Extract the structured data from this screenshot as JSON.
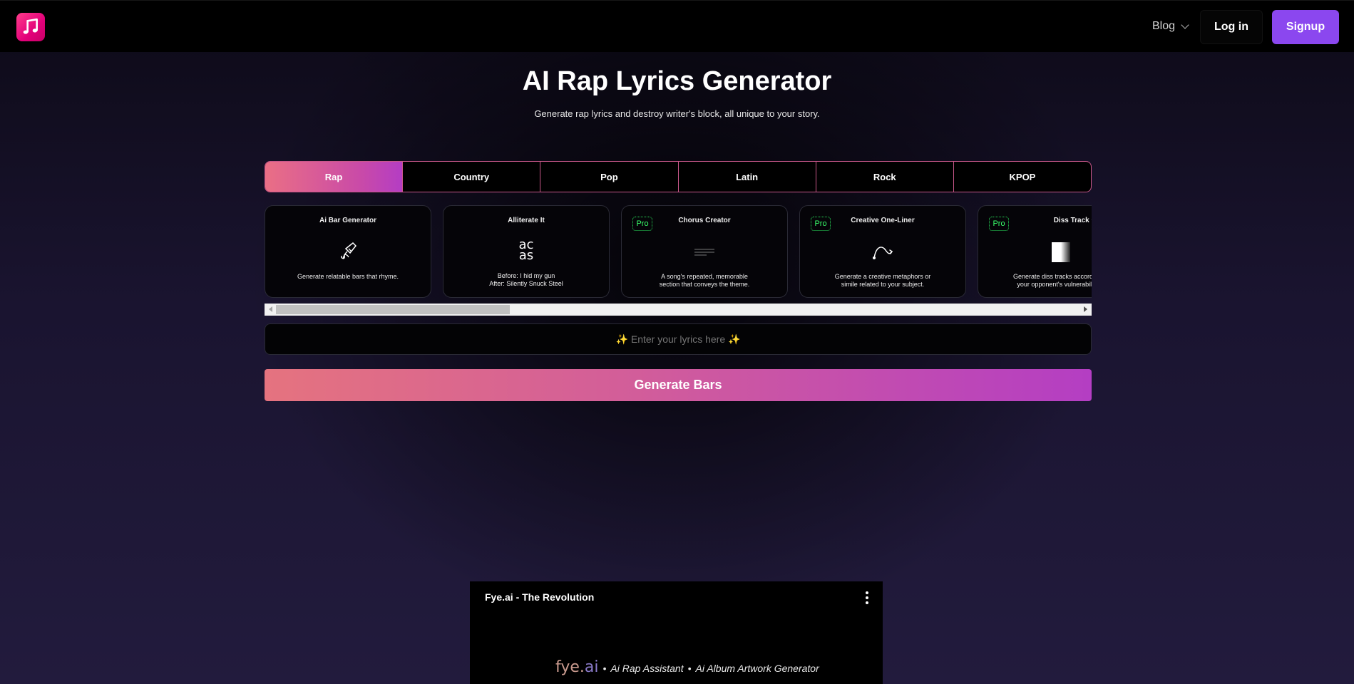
{
  "header": {
    "blog_label": "Blog",
    "login_label": "Log in",
    "signup_label": "Signup"
  },
  "hero": {
    "title": "AI Rap Lyrics Generator",
    "subtitle": "Generate rap lyrics and destroy writer's block, all unique to your story."
  },
  "tabs": [
    {
      "label": "Rap",
      "active": true
    },
    {
      "label": "Country"
    },
    {
      "label": "Pop"
    },
    {
      "label": "Latin"
    },
    {
      "label": "Rock"
    },
    {
      "label": "KPOP"
    }
  ],
  "tools": [
    {
      "title": "Ai Bar Generator",
      "desc": "Generate relatable bars that rhyme.",
      "pro": false,
      "icon": "pen-nib-icon"
    },
    {
      "title": "Alliterate It",
      "desc": "Before: I hid my gun\nAfter: Silently Snuck Steel",
      "pro": false,
      "icon": "letters-icon",
      "icon_text_top": "ac",
      "icon_text_bottom": "as"
    },
    {
      "title": "Chorus Creator",
      "desc": "A song's repeated, memorable\nsection that conveys the theme.",
      "pro": true,
      "icon": "lines-icon"
    },
    {
      "title": "Creative One-Liner",
      "desc": "Generate a creative metaphors or\nsimile related to your subject.",
      "pro": true,
      "icon": "curve-arrow-icon"
    },
    {
      "title": "Diss Track Generator",
      "desc": "Generate diss tracks according to\nyour opponent's vulnerabilities.",
      "pro": true,
      "icon": "gradient-block-icon"
    }
  ],
  "pro_label": "Pro",
  "lyrics_input": {
    "placeholder": "✨ Enter your lyrics here ✨"
  },
  "generate_label": "Generate Bars",
  "video": {
    "title": "Fye.ai - The Revolution",
    "brand_part1": "fye.",
    "brand_part2": "ai",
    "separator": "•",
    "item1": "Ai Rap Assistant",
    "item2": "Ai Album Artwork Generator"
  },
  "colors": {
    "accent_purple": "#8b47ef",
    "tab_border": "#c8578a",
    "pro_green": "#39ff6a"
  }
}
